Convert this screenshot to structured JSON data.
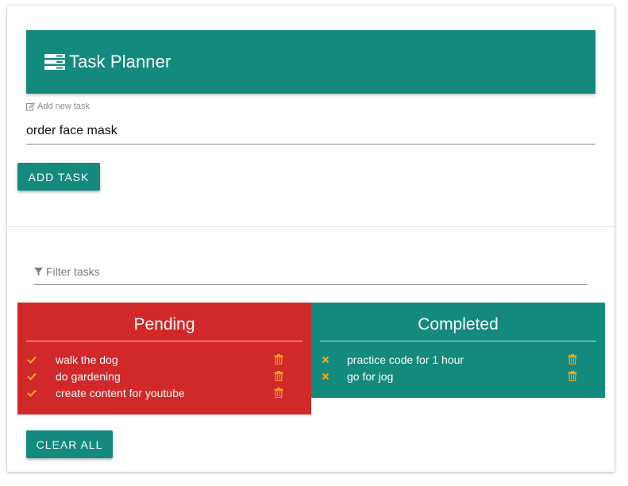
{
  "header": {
    "title": "Task Planner",
    "icon": "server-icon"
  },
  "new_task": {
    "label": "Add new task",
    "label_icon": "edit-icon",
    "value": "order face mask"
  },
  "add_button": {
    "label": "ADD TASK"
  },
  "filter": {
    "placeholder": "Filter tasks",
    "icon": "filter-icon"
  },
  "pending": {
    "title": "Pending",
    "items": [
      {
        "text": "walk the dog"
      },
      {
        "text": "do gardening"
      },
      {
        "text": "create content for youtube"
      }
    ]
  },
  "completed": {
    "title": "Completed",
    "items": [
      {
        "text": "practice code for 1 hour"
      },
      {
        "text": "go for jog"
      }
    ]
  },
  "clear_button": {
    "label": "CLEAR ALL"
  },
  "colors": {
    "primary": "#138a7d",
    "pending_bg": "#d1282a",
    "action_icon": "#f5a623"
  }
}
